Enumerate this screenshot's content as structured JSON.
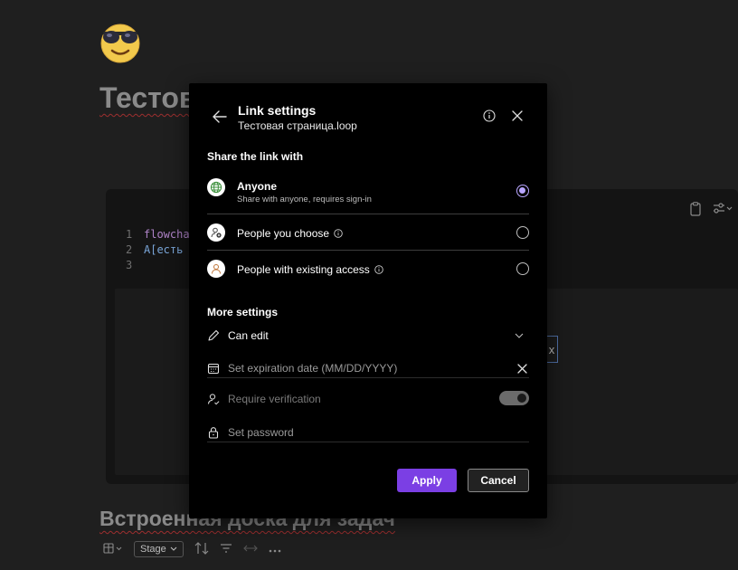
{
  "page": {
    "title": "Тестов",
    "section_title": "Встроенная доска для задач",
    "code_lines": [
      {
        "num": "1",
        "text": "flowcha",
        "kind": "keyword"
      },
      {
        "num": "2",
        "text": "A[есть",
        "kind": "text"
      },
      {
        "num": "3",
        "text": "",
        "kind": "text"
      }
    ],
    "preview_node_text": "x",
    "board_toolbar": {
      "stage_label": "Stage"
    }
  },
  "dialog": {
    "title": "Link settings",
    "subtitle": "Тестовая страница.loop",
    "share_heading": "Share the link with",
    "options": [
      {
        "label": "Anyone",
        "description": "Share with anyone, requires sign-in",
        "icon": "globe-icon",
        "selected": true
      },
      {
        "label": "People you choose",
        "description": "",
        "icon": "person-add-icon",
        "selected": false
      },
      {
        "label": "People with existing access",
        "description": "",
        "icon": "person-icon",
        "selected": false
      }
    ],
    "more_heading": "More settings",
    "permission_value": "Can edit",
    "expiration_placeholder": "Set expiration date (MM/DD/YYYY)",
    "verification_label": "Require verification",
    "password_placeholder": "Set password",
    "apply_label": "Apply",
    "cancel_label": "Cancel"
  },
  "colors": {
    "accent": "#7b3fe4",
    "radio_selected": "#b9a6ff",
    "dialog_bg": "#000000",
    "page_bg": "#1f1f1f"
  }
}
